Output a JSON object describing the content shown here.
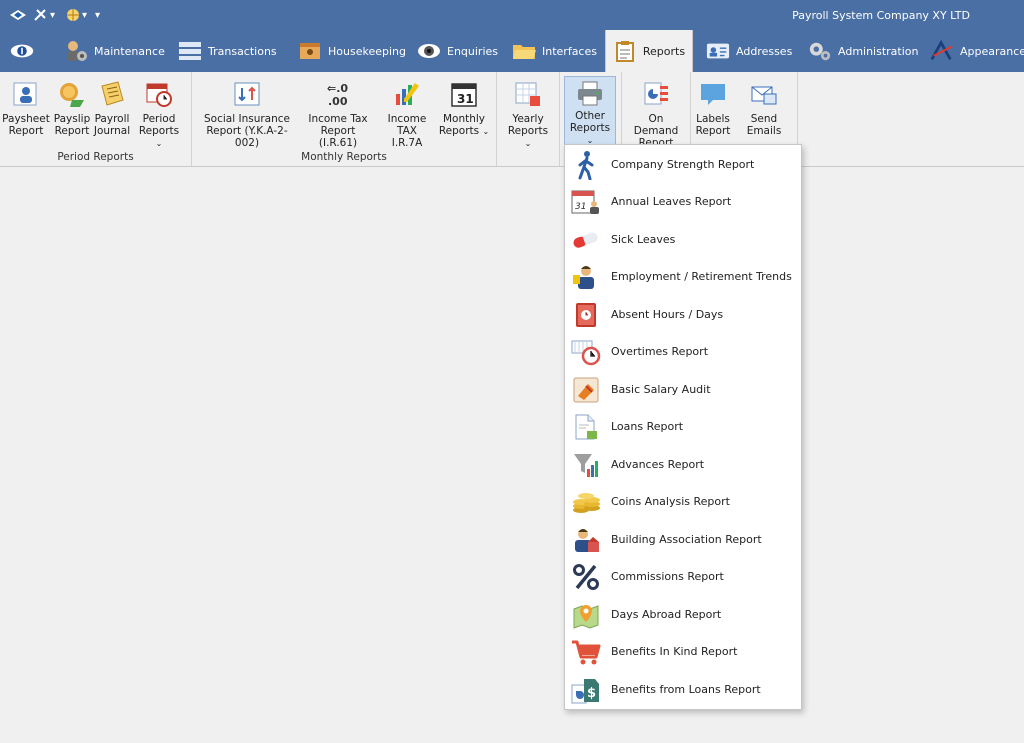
{
  "title_bar": {
    "app_title": "Payroll System Company XY LTD",
    "quick_access": [
      {
        "name": "logo-icon"
      },
      {
        "name": "tools-icon",
        "has_caret": true
      },
      {
        "name": "globe-icon",
        "has_caret": true
      },
      {
        "name": "customize-icon"
      }
    ]
  },
  "tabs": [
    {
      "label": "",
      "icon": "eye-logo-icon"
    },
    {
      "label": "Maintenance",
      "icon": "maintenance-icon"
    },
    {
      "label": "Transactions",
      "icon": "transactions-icon"
    },
    {
      "label": "Housekeeping",
      "icon": "housekeeping-icon"
    },
    {
      "label": "Enquiries",
      "icon": "enquiries-icon"
    },
    {
      "label": "Interfaces",
      "icon": "folder-icon"
    },
    {
      "label": "Reports",
      "icon": "reports-icon",
      "active": true
    },
    {
      "label": "Addresses",
      "icon": "addresses-icon"
    },
    {
      "label": "Administration",
      "icon": "gears-icon"
    },
    {
      "label": "Appearance",
      "icon": "appearance-icon"
    }
  ],
  "ribbon": {
    "groups": [
      {
        "label": "Period Reports",
        "buttons": [
          {
            "line1": "Paysheet",
            "line2": "Report",
            "icon": "paysheet-icon"
          },
          {
            "line1": "Payslip",
            "line2": "Report",
            "icon": "payslip-icon"
          },
          {
            "line1": "Payroll",
            "line2": "Journal",
            "icon": "journal-icon"
          },
          {
            "line1": "Period",
            "line2": "Reports",
            "icon": "period-icon",
            "caret": true
          }
        ]
      },
      {
        "label": "Monthly Reports",
        "buttons": [
          {
            "line1": "Social Insurance",
            "line2": "Report (Y.K.A-2-002)",
            "icon": "social-insurance-icon"
          },
          {
            "line1": "Income Tax",
            "line2": "Report (I.R.61)",
            "icon": "decimal-icon"
          },
          {
            "line1": "Income TAX",
            "line2": "I.R.7A",
            "icon": "pencils-icon"
          },
          {
            "line1": "Monthly",
            "line2": "Reports",
            "icon": "calendar-31-icon",
            "caret": true
          }
        ]
      },
      {
        "label": "",
        "buttons": [
          {
            "line1": "Yearly",
            "line2": "Reports",
            "icon": "yearly-icon",
            "caret": true
          }
        ]
      },
      {
        "label": "",
        "buttons": [
          {
            "line1": "Other",
            "line2": "Reports",
            "icon": "printer-icon",
            "caret": true,
            "pressed": true
          }
        ]
      },
      {
        "label": "",
        "buttons": [
          {
            "line1": "On Demand",
            "line2": "Report",
            "icon": "on-demand-icon"
          }
        ]
      },
      {
        "label": "",
        "buttons": [
          {
            "line1": "Labels",
            "line2": "Report",
            "icon": "labels-icon"
          },
          {
            "line1": "Send Emails",
            "line2": "",
            "icon": "email-icon"
          }
        ]
      }
    ]
  },
  "other_reports_menu": [
    {
      "label": "Company Strength Report",
      "icon": "walking-person-icon"
    },
    {
      "label": "Annual Leaves Report",
      "icon": "calendar-person-icon"
    },
    {
      "label": "Sick Leaves",
      "icon": "pill-icon"
    },
    {
      "label": "Employment / Retirement Trends",
      "icon": "person-trends-icon"
    },
    {
      "label": "Absent Hours / Days",
      "icon": "absent-book-icon"
    },
    {
      "label": "Overtimes Report",
      "icon": "overtime-clock-icon"
    },
    {
      "label": "Basic Salary Audit",
      "icon": "salary-audit-icon"
    },
    {
      "label": "Loans Report",
      "icon": "loans-document-icon"
    },
    {
      "label": "Advances Report",
      "icon": "funnel-chart-icon"
    },
    {
      "label": "Coins Analysis Report",
      "icon": "coins-icon"
    },
    {
      "label": "Building Association Report",
      "icon": "building-association-icon"
    },
    {
      "label": "Commissions Report",
      "icon": "percent-icon"
    },
    {
      "label": "Days Abroad Report",
      "icon": "map-pin-icon"
    },
    {
      "label": "Benefits In Kind Report",
      "icon": "shopping-cart-icon"
    },
    {
      "label": "Benefits from Loans Report",
      "icon": "benefits-loans-icon"
    }
  ]
}
